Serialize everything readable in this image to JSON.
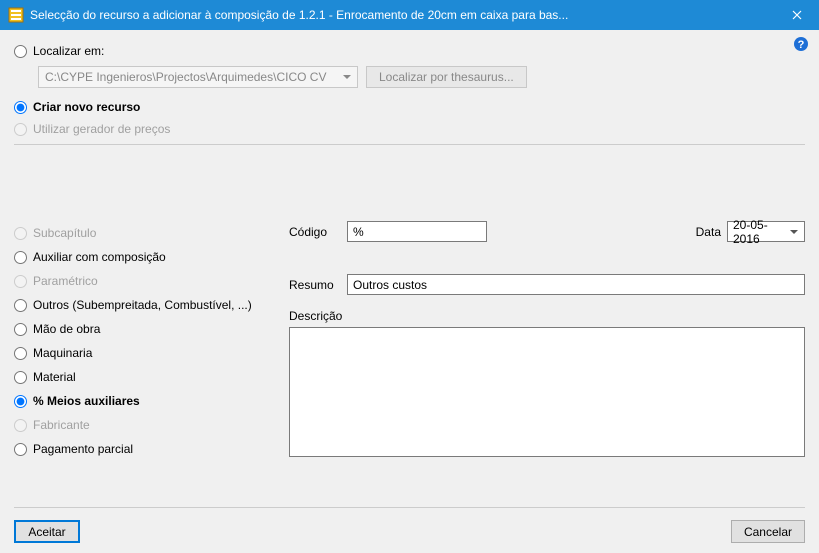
{
  "titlebar": {
    "title": "Selecção do recurso a adicionar à composição de 1.2.1 - Enrocamento de 20cm em caixa para bas...",
    "close": "×"
  },
  "top": {
    "localizar_label": "Localizar em:",
    "path": "C:\\CYPE Ingenieros\\Projectos\\Arquimedes\\CICO CV",
    "thesaurus_btn": "Localizar por thesaurus...",
    "criar_label": "Criar novo recurso",
    "gerador_label": "Utilizar gerador de preços"
  },
  "categories": {
    "subcapitulo": "Subcapítulo",
    "auxiliar": "Auxiliar com composição",
    "parametrico": "Paramétrico",
    "outros": "Outros (Subempreitada, Combustível, ...)",
    "mao_obra": "Mão de obra",
    "maquinaria": "Maquinaria",
    "material": "Material",
    "meios_aux": "% Meios auxiliares",
    "fabricante": "Fabricante",
    "pagamento": "Pagamento parcial"
  },
  "form": {
    "codigo_label": "Código",
    "codigo_value": "%",
    "data_label": "Data",
    "data_value": "20-05-2016",
    "resumo_label": "Resumo",
    "resumo_value": "Outros custos",
    "descricao_label": "Descrição"
  },
  "buttons": {
    "accept": "Aceitar",
    "cancel": "Cancelar"
  }
}
